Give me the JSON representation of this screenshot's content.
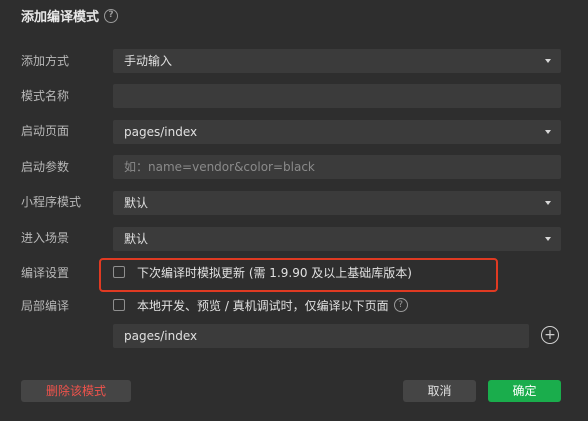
{
  "dialog": {
    "title": "添加编译模式",
    "title_help_icon": "?"
  },
  "form": {
    "add_method": {
      "label": "添加方式",
      "value": "手动输入"
    },
    "mode_name": {
      "label": "模式名称",
      "value": ""
    },
    "start_page": {
      "label": "启动页面",
      "value": "pages/index"
    },
    "start_params": {
      "label": "启动参数",
      "placeholder": "如：name=vendor&color=black"
    },
    "mini_program_mode": {
      "label": "小程序模式",
      "value": "默认"
    },
    "enter_scene": {
      "label": "进入场景",
      "value": "默认"
    },
    "compile_settings": {
      "label": "编译设置",
      "checkbox_label": "下次编译时模拟更新 (需 1.9.90 及以上基础库版本)",
      "checked": false
    },
    "partial_compile": {
      "label": "局部编译",
      "checkbox_label": "本地开发、预览 / 真机调试时，仅编译以下页面",
      "checked": false,
      "help_icon": "?",
      "page_value": "pages/index",
      "add_icon": "+"
    }
  },
  "buttons": {
    "delete": "删除该模式",
    "cancel": "取消",
    "confirm": "确定"
  },
  "colors": {
    "background": "#2e2e2e",
    "field": "#3b3b3b",
    "primary": "#1aad4c",
    "danger": "#f0534c",
    "highlight": "#e03a22"
  }
}
